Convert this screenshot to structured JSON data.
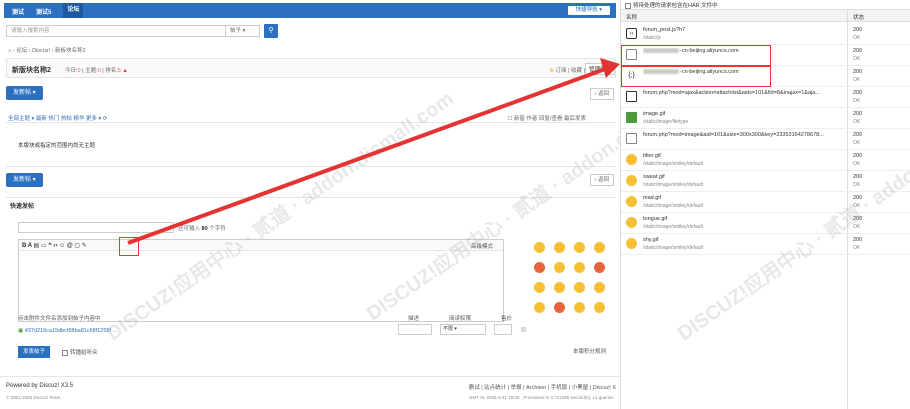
{
  "topbar": {
    "nav": [
      "测试",
      "测试5",
      "论坛"
    ],
    "quicknav": "快捷导航 ▾"
  },
  "search": {
    "placeholder": "请输入搜索内容",
    "type": "帖子 ▾",
    "button_icon": "search-icon"
  },
  "breadcrumb": "⌂ › 论坛 › Discuz! › 新板块名称2",
  "forum": {
    "name": "新版块名称2",
    "stats_today_label": "今日:",
    "stats_today": "0",
    "stats_topics_label": "主题:",
    "stats_topics": "0",
    "stats_rank_label": "排名:",
    "stats_rank": "5",
    "actions": "订阅 | 收藏 |",
    "manage": "管理面板"
  },
  "new_post_button": "发新帖 ▾",
  "back_button": "‹ 返回",
  "threadbar": {
    "filters": "全部主题 ▾  最新  热门  热帖  精华  更多 ▾  ⟳",
    "right": "☐ 新窗  作者    回复/查看  最后发表"
  },
  "empty_message": "本版块或指定的范围内尚无主题",
  "quickpost": {
    "title": "快速发帖",
    "limit_prefix": "还可输入",
    "limit_num": "80",
    "limit_suffix": "个字符",
    "tools": "B A ▤ ▭ ❝ ‹› ☺ @ ▢ ✎",
    "advanced": "高级模式",
    "attach_hint": "点击附件文件名添加到帖子内容中",
    "attach_file": "437d216ca15dbcf98ba81c68f1255f ...",
    "col_desc": "描述",
    "col_perm": "阅读权限",
    "col_price": "售价",
    "perm_value": "不限",
    "post_button": "发表帖子",
    "checkbox_label": "转播给听众",
    "rules": "本版积分规则"
  },
  "footer": {
    "powered": "Powered by Discuz! X3.5",
    "copyright": "© 2001-2025 Discuz! Team.",
    "links": "删试 | 站点统计 | 举报 | Archiver | 手机版 | 小黑屋 | Discuz! X",
    "gmt": "GMT+8, 2025-3-21 15:00 , Processed in 0.711299 second(s), 14 queries ."
  },
  "watermark": "DISCUZ!应用中心 · 贰道 · addon.dismall.com",
  "devtools": {
    "har_option": "将待处理的请求包含在HAR 文件中",
    "col_name": "名称",
    "col_status": "状态",
    "rows": [
      {
        "icon": "js-icon",
        "name": "forum_post.js?h7",
        "path": "/static/js",
        "status": "200",
        "status_text": "OK",
        "blur": false
      },
      {
        "icon": "blank-file-icon",
        "name": "-cn-beijing.aliyuncs.com",
        "path": "",
        "status": "200",
        "status_text": "OK",
        "blur": true
      },
      {
        "icon": "braces-icon",
        "name": "-cn-beijing.aliyuncs.com",
        "path": "",
        "status": "200",
        "status_text": "OK",
        "blur": true
      },
      {
        "icon": "document-icon",
        "name": "forum.php?mod=ajax&action=attachlist&aids=101&fid=8&inajax=1&aja...",
        "path": "",
        "status": "200",
        "status_text": "OK",
        "blur": false
      },
      {
        "icon": "image-icon",
        "name": "image.gif",
        "path": "/static/image/filetype",
        "status": "200",
        "status_text": "OK",
        "blur": false
      },
      {
        "icon": "image-blank-icon",
        "name": "forum.php?mod=image&aid=101&size=300x300&key=23353164278678...",
        "path": "",
        "status": "200",
        "status_text": "OK",
        "blur": false
      },
      {
        "icon": "smiley-icon",
        "name": "titter.gif",
        "path": "/static/image/smiley/default",
        "status": "200",
        "status_text": "OK",
        "blur": false
      },
      {
        "icon": "smiley-icon",
        "name": "sweat.gif",
        "path": "/static/image/smiley/default",
        "status": "200",
        "status_text": "OK",
        "blur": false
      },
      {
        "icon": "smiley-icon",
        "name": "mad.gif",
        "path": "/static/image/smiley/default",
        "status": "200",
        "status_text": "OK",
        "blur": false
      },
      {
        "icon": "smiley-icon",
        "name": "tongue.gif",
        "path": "/static/image/smiley/default",
        "status": "200",
        "status_text": "OK",
        "blur": false
      },
      {
        "icon": "smiley-icon",
        "name": "shy.gif",
        "path": "/static/image/smiley/default",
        "status": "200",
        "status_text": "OK",
        "blur": false
      }
    ]
  },
  "colors": {
    "brand_blue": "#2b71c0",
    "arrow_red": "#e33333",
    "stat_orange": "#f26c4f"
  }
}
